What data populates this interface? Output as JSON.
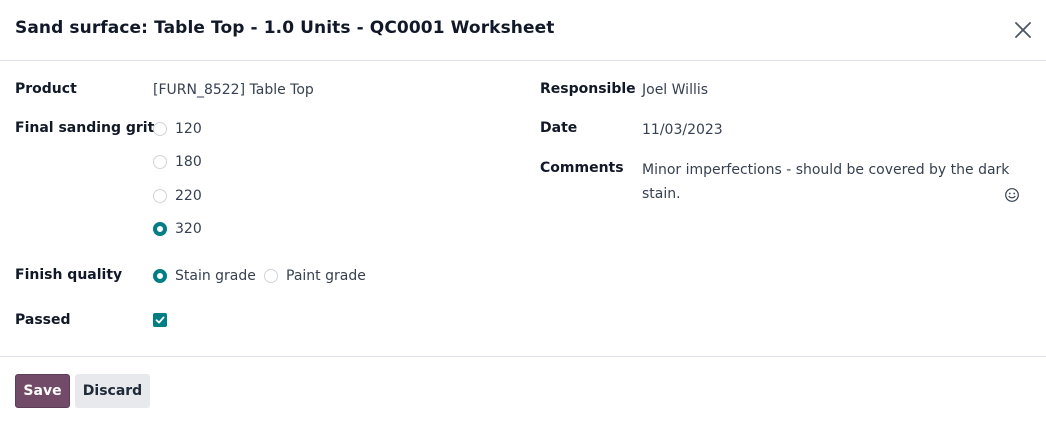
{
  "dialog": {
    "title": "Sand surface: Table Top - 1.0 Units - QC0001 Worksheet"
  },
  "fields": {
    "product_label": "Product",
    "product_value": "[FURN_8522] Table Top",
    "grit_label": "Final sanding grit",
    "grit_options": [
      "120",
      "180",
      "220",
      "320"
    ],
    "grit_selected": "320",
    "finish_label": "Finish quality",
    "finish_options": [
      "Stain grade",
      "Paint grade"
    ],
    "finish_selected": "Stain grade",
    "passed_label": "Passed",
    "passed_checked": true,
    "responsible_label": "Responsible",
    "responsible_value": "Joel Willis",
    "date_label": "Date",
    "date_value": "11/03/2023",
    "comments_label": "Comments",
    "comments_value": "Minor imperfections - should be covered by the dark stain."
  },
  "footer": {
    "save_label": "Save",
    "discard_label": "Discard"
  },
  "colors": {
    "accent": "#017e84",
    "primary_button": "#714b67"
  },
  "icons": {
    "close": "close-icon",
    "emoji": "smiley-icon",
    "check": "checkmark-icon"
  }
}
